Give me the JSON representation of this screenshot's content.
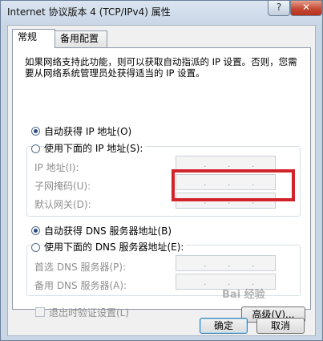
{
  "window": {
    "title": "Internet 协议版本 4 (TCP/IPv4) 属性",
    "help_label": "?",
    "close_label": "✕"
  },
  "tabs": [
    {
      "label": "常规"
    },
    {
      "label": "备用配置"
    }
  ],
  "description": "如果网络支持此功能，则可以获取自动指派的 IP 设置。否则，您需要从网络系统管理员处获得适当的 IP 设置。",
  "ip_section": {
    "auto_label": "自动获得 IP 地址(O)",
    "manual_label": "使用下面的 IP 地址(S):",
    "auto_selected": true,
    "fields": [
      {
        "label": "IP 地址(I):",
        "value": ". . ."
      },
      {
        "label": "子网掩码(U):",
        "value": ". . ."
      },
      {
        "label": "默认网关(D):",
        "value": ". . ."
      }
    ]
  },
  "dns_section": {
    "auto_label": "自动获得 DNS 服务器地址(B)",
    "manual_label": "使用下面的 DNS 服务器地址(E):",
    "auto_selected": true,
    "fields": [
      {
        "label": "首选 DNS 服务器(P):",
        "value": ". . ."
      },
      {
        "label": "备用 DNS 服务器(A):",
        "value": ". . ."
      }
    ]
  },
  "validate_label": "退出时验证设置(L)",
  "advanced_label": "高级(V)...",
  "ok_label": "确定",
  "cancel_label": "取消",
  "watermark": "Bai 经验",
  "colors": {
    "highlight": "#d2232a",
    "close_button": "#c44a33"
  }
}
